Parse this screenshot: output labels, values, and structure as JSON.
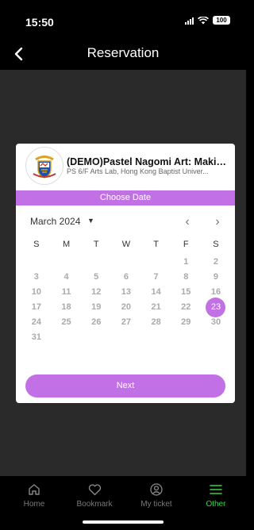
{
  "status": {
    "time": "15:50",
    "battery": "100"
  },
  "header": {
    "title": "Reservation"
  },
  "event": {
    "title": "(DEMO)Pastel Nagomi Art: Making...",
    "venue": "PS 6/F Arts Lab, Hong Kong Baptist Univer..."
  },
  "calendar": {
    "choose_label": "Choose Date",
    "month": "March 2024",
    "prev": "‹",
    "next": "›",
    "weekdays": [
      "S",
      "M",
      "T",
      "W",
      "T",
      "F",
      "S"
    ],
    "weeks": [
      [
        "",
        "",
        "",
        "",
        "",
        "1",
        "2"
      ],
      [
        "3",
        "4",
        "5",
        "6",
        "7",
        "8",
        "9"
      ],
      [
        "10",
        "11",
        "12",
        "13",
        "14",
        "15",
        "16"
      ],
      [
        "17",
        "18",
        "19",
        "20",
        "21",
        "22",
        "23"
      ],
      [
        "24",
        "25",
        "26",
        "27",
        "28",
        "29",
        "30"
      ],
      [
        "31",
        "",
        "",
        "",
        "",
        "",
        ""
      ]
    ],
    "selected": "23",
    "next_button": "Next"
  },
  "tabs": [
    {
      "label": "Home",
      "icon": "home-icon"
    },
    {
      "label": "Bookmark",
      "icon": "heart-icon"
    },
    {
      "label": "My ticket",
      "icon": "user-icon"
    },
    {
      "label": "Other",
      "icon": "menu-icon",
      "active": true
    }
  ],
  "colors": {
    "accent": "#c270e5",
    "active_tab": "#38d14e"
  }
}
